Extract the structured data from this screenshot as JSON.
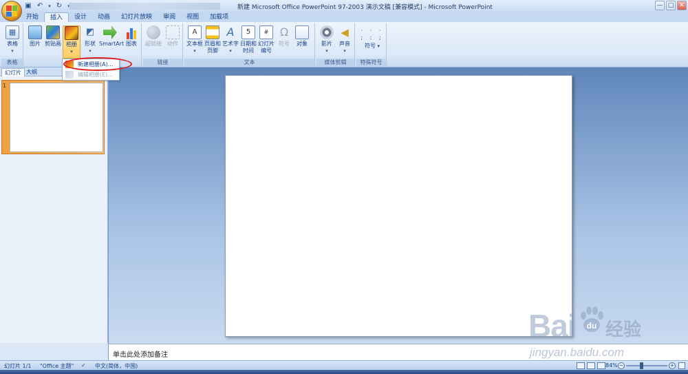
{
  "window": {
    "title": "新建 Microsoft Office PowerPoint 97-2003 演示文稿 [兼容模式] - Microsoft PowerPoint",
    "controls": [
      "—",
      "□",
      "✕"
    ]
  },
  "tabs": [
    {
      "label": "开始",
      "active": false
    },
    {
      "label": "插入",
      "active": true
    },
    {
      "label": "设计",
      "active": false
    },
    {
      "label": "动画",
      "active": false
    },
    {
      "label": "幻灯片放映",
      "active": false
    },
    {
      "label": "审阅",
      "active": false
    },
    {
      "label": "视图",
      "active": false
    },
    {
      "label": "加载项",
      "active": false
    }
  ],
  "ribbon": {
    "groups": {
      "tables": "表格",
      "links": "链接",
      "text": "文本",
      "media": "媒体剪辑",
      "special": "特殊符号"
    },
    "buttons": {
      "table": "表格",
      "picture": "图片",
      "clipart": "剪贴画",
      "album": "相册",
      "shapes": "形状",
      "smartart": "SmartArt",
      "chart": "图表",
      "hyperlink": "超链接",
      "action": "动作",
      "textbox": "文本框",
      "header_l1": "页眉和",
      "header_l2": "页脚",
      "wordart": "艺术字",
      "datetime_l1": "日期和",
      "datetime_l2": "时间",
      "slidenum_l1": "幻灯片",
      "slidenum_l2": "编号",
      "symbol": "符号",
      "object": "对象",
      "movie": "影片",
      "sound": "声音",
      "symbols": "符号"
    }
  },
  "album_menu": {
    "items": [
      {
        "label": "新建相册(A)...",
        "enabled": true
      },
      {
        "label": "编辑相册(E)...",
        "enabled": false
      }
    ]
  },
  "left_panel": {
    "tabs": [
      "幻灯片",
      "大纲"
    ],
    "close": "✕",
    "slide_number": "1"
  },
  "notes": {
    "placeholder": "单击此处添加备注"
  },
  "status": {
    "slide": "幻灯片 1/1",
    "theme": "\"Office 主题\"",
    "language": "中文(简体，中国)",
    "zoom": "84%"
  },
  "watermark": {
    "brand": "Bai",
    "brand2": "经验",
    "url": "jingyan.baidu.com"
  },
  "colors": {
    "accent": "#15428b",
    "selection": "#ffcf63",
    "highlight_circle": "#e02020"
  }
}
